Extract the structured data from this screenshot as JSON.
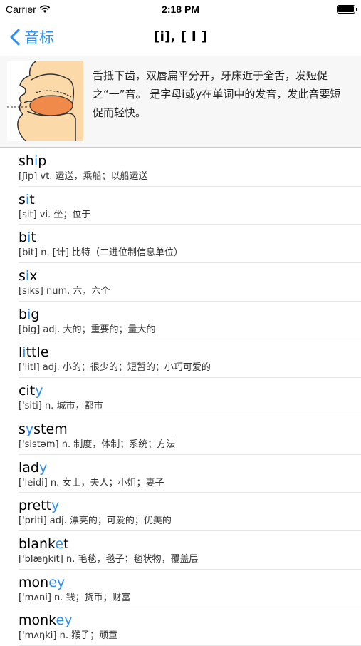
{
  "status_bar": {
    "carrier": "Carrier",
    "time": "2:18 PM",
    "battery_level": 1.0
  },
  "nav": {
    "back_label": "音标",
    "title": "[i], [ I ]"
  },
  "intro": {
    "image_icon": "mouth-cross-section-icon",
    "text": "舌抵下齿，双唇扁平分开，牙床近于全舌，发短促之“一”音。 是字母i或y在单词中的发音，发此音要短促而轻快。"
  },
  "accent_color": "#2b8ef2",
  "words": [
    {
      "pre": "sh",
      "hl": "i",
      "post": "p",
      "meaning": "[ʃip]  vt. 运送，乘船；以船运送"
    },
    {
      "pre": "s",
      "hl": "i",
      "post": "t",
      "meaning": "[sit]  vi. 坐；位于"
    },
    {
      "pre": "b",
      "hl": "i",
      "post": "t",
      "meaning": "[bit]  n. [计] 比特（二进位制信息单位）"
    },
    {
      "pre": "s",
      "hl": "i",
      "post": "x",
      "meaning": "[siks]  num. 六，六个"
    },
    {
      "pre": "b",
      "hl": "i",
      "post": "g",
      "meaning": "[big]  adj. 大的；重要的；量大的"
    },
    {
      "pre": "l",
      "hl": "i",
      "post": "ttle",
      "meaning": "['litl]  adj. 小的；很少的；短暂的；小巧可爱的"
    },
    {
      "pre": "cit",
      "hl": "y",
      "post": "",
      "meaning": "['siti]  n. 城市，都市"
    },
    {
      "pre": "s",
      "hl": "y",
      "post": "stem",
      "meaning": "['sistəm]  n. 制度，体制；系统；方法"
    },
    {
      "pre": "lad",
      "hl": "y",
      "post": "",
      "meaning": "['leidi]  n. 女士，夫人；小姐；妻子"
    },
    {
      "pre": "prett",
      "hl": "y",
      "post": "",
      "meaning": "['priti]  adj. 漂亮的；可爱的；优美的"
    },
    {
      "pre": "blank",
      "hl": "e",
      "post": "t",
      "meaning": "['blæŋkit]  n. 毛毯，毯子；毯状物，覆盖层"
    },
    {
      "pre": "mon",
      "hl": "ey",
      "post": "",
      "meaning": "['mʌni]  n. 钱；货币；财富"
    },
    {
      "pre": "monk",
      "hl": "ey",
      "post": "",
      "meaning": "['mʌŋki]  n. 猴子；顽童"
    }
  ]
}
